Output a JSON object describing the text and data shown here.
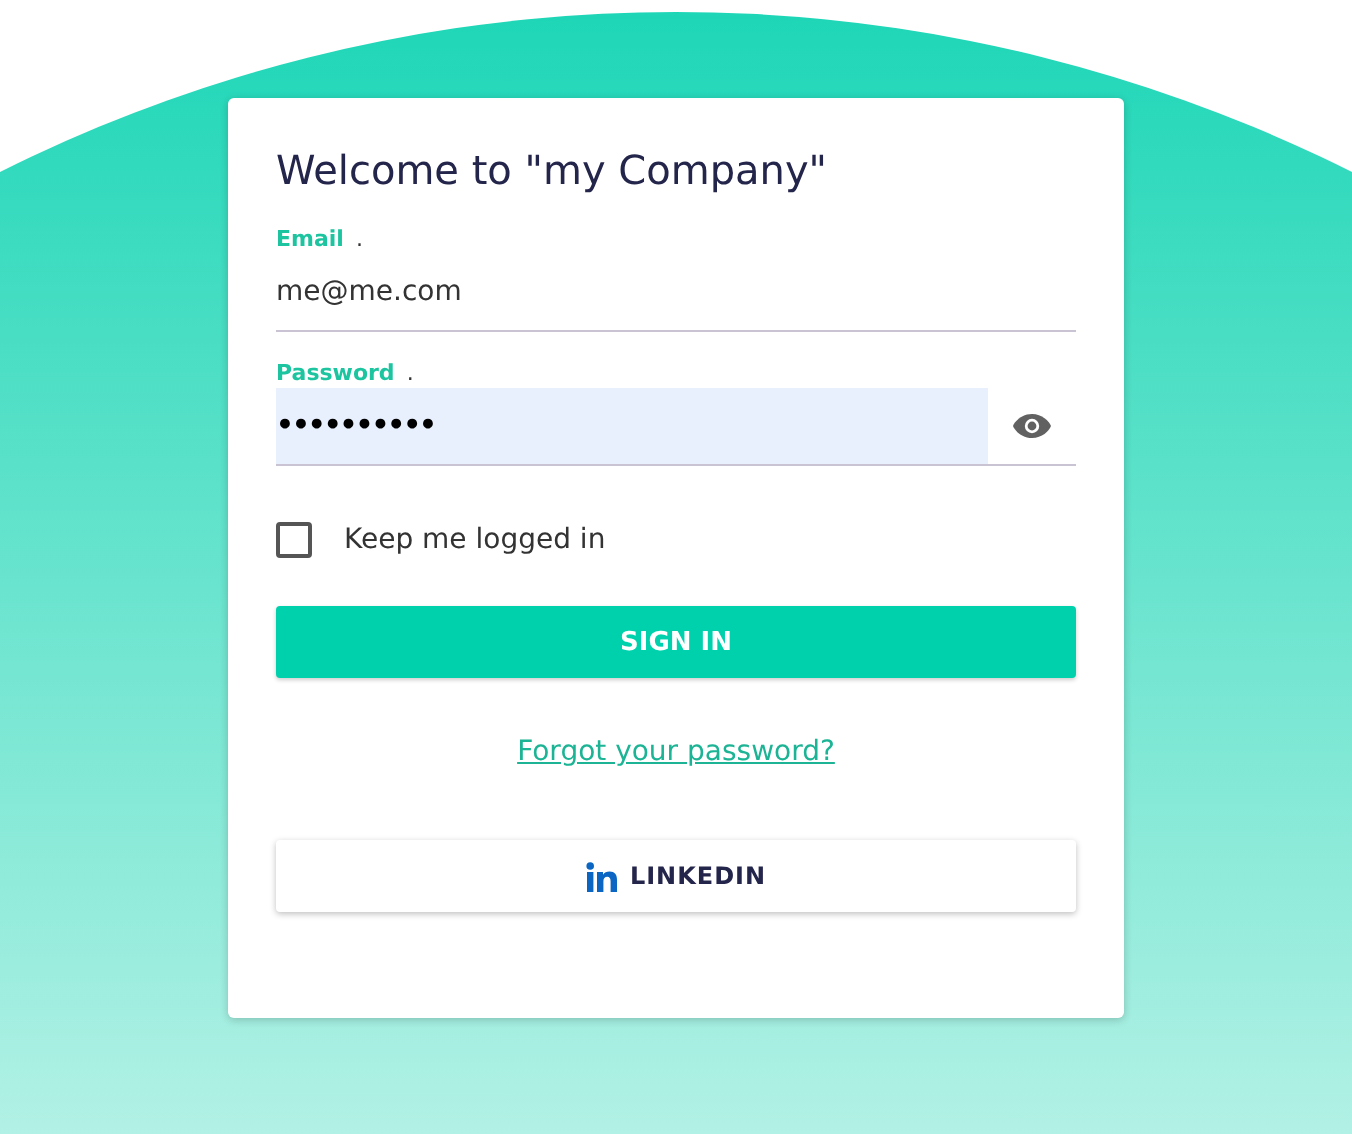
{
  "login_card": {
    "title": "Welcome to \"my Company\"",
    "fields": [
      {
        "kind": "text",
        "label": "Email",
        "required_mark": ".",
        "value": "me@me.com",
        "autofilled": false
      },
      {
        "kind": "password",
        "label": "Password",
        "required_mark": ".",
        "value": "••••••••••",
        "autofilled": true
      }
    ],
    "keep_logged_in": {
      "label": "Keep me logged in",
      "checked": false
    },
    "sign_in_button": "SIGN IN",
    "forgot_password_link": "Forgot your password?",
    "linkedin_button": "LINKEDIN"
  }
}
